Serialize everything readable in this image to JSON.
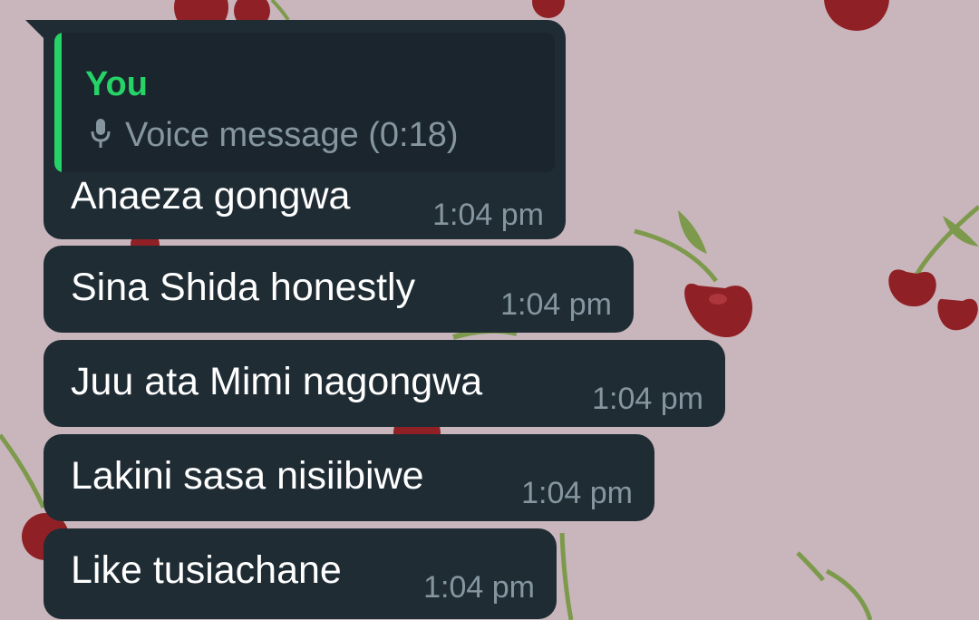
{
  "wallpaper": {
    "background": "#c9b6bc",
    "cherry_color": "#8f2025",
    "leaf_color": "#7d9a4c"
  },
  "colors": {
    "bubble": "#1f2c34",
    "accent": "#25d366",
    "meta": "#8696a0",
    "text": "#ffffff"
  },
  "messages": [
    {
      "reply": {
        "author": "You",
        "icon": "mic-icon",
        "text": "Voice message (0:18)"
      },
      "text": "Anaeza gongwa",
      "time": "1:04 pm"
    },
    {
      "text": "Sina Shida honestly",
      "time": "1:04 pm"
    },
    {
      "text": "Juu ata Mimi nagongwa",
      "time": "1:04 pm"
    },
    {
      "text": "Lakini sasa nisiibiwe",
      "time": "1:04 pm"
    },
    {
      "text": "Like tusiachane",
      "time": "1:04 pm"
    }
  ]
}
